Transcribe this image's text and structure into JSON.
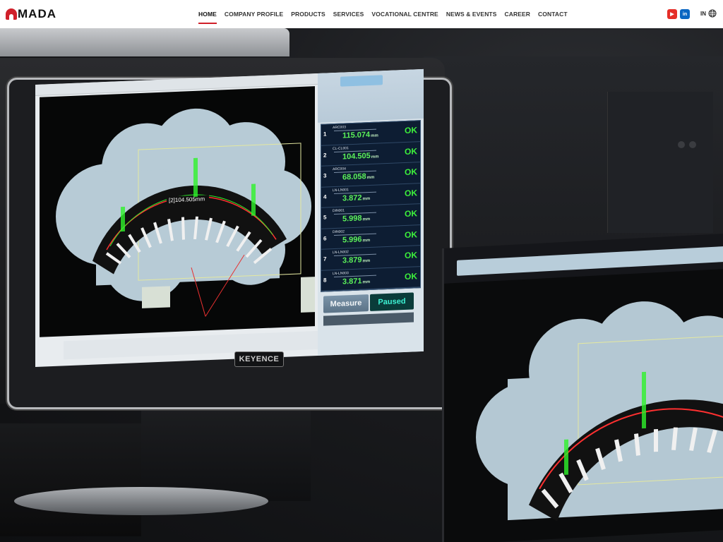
{
  "brand": {
    "logo_text": "MADA",
    "accent": "#d0202a"
  },
  "nav": {
    "items": [
      "HOME",
      "COMPANY PROFILE",
      "PRODUCTS",
      "SERVICES",
      "VOCATIONAL CENTRE",
      "NEWS & EVENTS",
      "CAREER",
      "CONTACT"
    ],
    "active": "HOME"
  },
  "social": {
    "youtube_label": "▶",
    "linkedin_label": "in"
  },
  "language": {
    "code": "IN"
  },
  "hero": {
    "device_brand": "KEYENCE",
    "measurements": [
      {
        "num": "1",
        "name": "ARC003",
        "value": "115.074",
        "unit": "mm",
        "status": "OK"
      },
      {
        "num": "2",
        "name": "CL-CL001",
        "value": "104.505",
        "unit": "mm",
        "status": "OK"
      },
      {
        "num": "3",
        "name": "ARC004",
        "value": "68.058",
        "unit": "mm",
        "status": "OK"
      },
      {
        "num": "4",
        "name": "LN-LN001",
        "value": "3.872",
        "unit": "mm",
        "status": "OK"
      },
      {
        "num": "5",
        "name": "DIN001",
        "value": "5.998",
        "unit": "mm",
        "status": "OK"
      },
      {
        "num": "6",
        "name": "DIN002",
        "value": "5.996",
        "unit": "mm",
        "status": "OK"
      },
      {
        "num": "7",
        "name": "LN-LN002",
        "value": "3.879",
        "unit": "mm",
        "status": "OK"
      },
      {
        "num": "8",
        "name": "LN-LN003",
        "value": "3.871",
        "unit": "mm",
        "status": "OK"
      }
    ],
    "measure_button": "Measure",
    "paused_button": "Paused",
    "arc_label": "[2]104.505mm"
  },
  "slider": {
    "count": 7,
    "active_index": 6
  }
}
